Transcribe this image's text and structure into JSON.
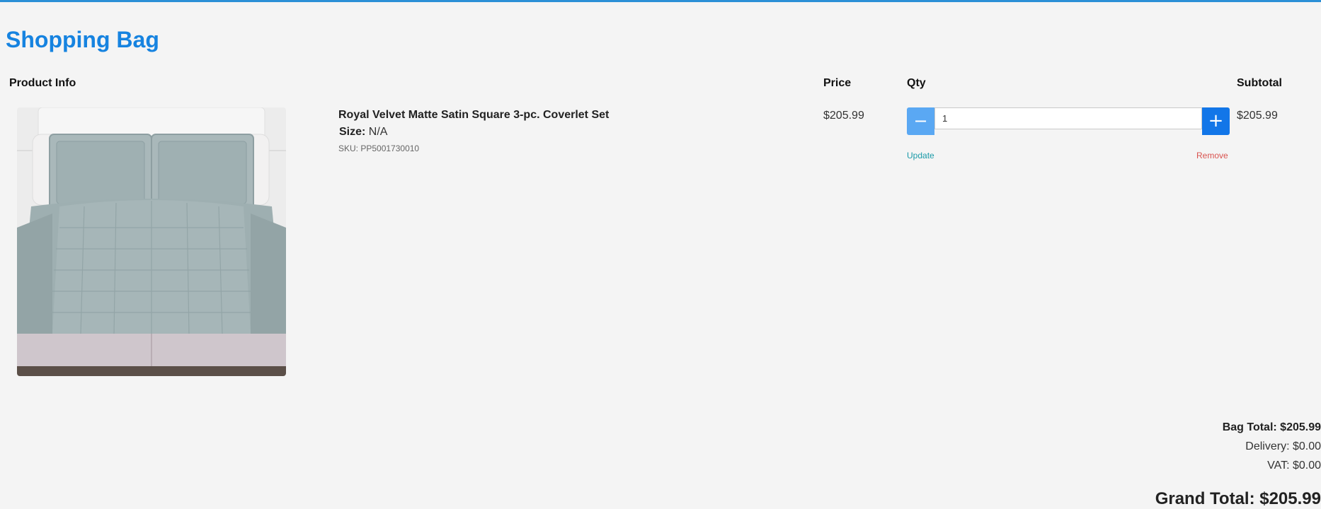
{
  "page": {
    "title": "Shopping Bag"
  },
  "columns": {
    "product_info": "Product Info",
    "price": "Price",
    "qty": "Qty",
    "subtotal": "Subtotal"
  },
  "item": {
    "name": "Royal Velvet Matte Satin Square 3-pc. Coverlet Set",
    "size_label": "Size:",
    "size_value": "N/A",
    "sku": "SKU: PP5001730010",
    "price": "$205.99",
    "quantity": "1",
    "subtotal": "$205.99",
    "image_icon": "coverlet-product-photo"
  },
  "qty_controls": {
    "minus_symbol": "−",
    "plus_symbol": "+",
    "update_label": "Update",
    "remove_label": "Remove"
  },
  "totals": {
    "bag_total": "Bag Total: $205.99",
    "delivery": "Delivery: $0.00",
    "vat": "VAT: $0.00",
    "grand_total": "Grand Total: $205.99"
  },
  "colors": {
    "accent": "#1683e0",
    "top_border": "#2b8fd6",
    "minus_button": "#5aa8f3",
    "plus_button": "#1276e8",
    "update_link": "#1a9aa8",
    "remove_link": "#d9534f"
  }
}
